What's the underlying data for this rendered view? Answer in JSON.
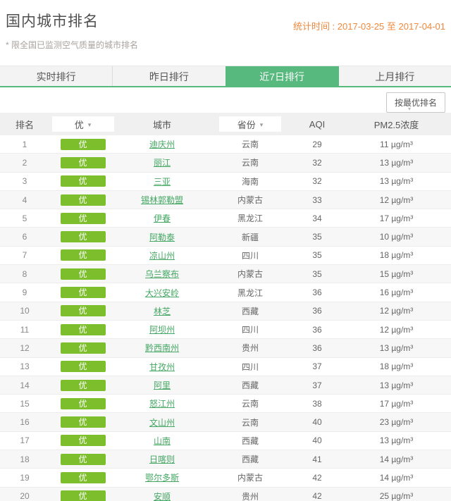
{
  "page": {
    "title": "国内城市排名",
    "subtitle": "* 限全国已监测空气质量的城市排名",
    "stat_time": "统计时间 : 2017-03-25 至 2017-04-01"
  },
  "colors": {
    "accent_green": "#57b97e",
    "badge_green": "#7dbe2d",
    "link_green": "#44a763",
    "stat_orange": "#f0883e",
    "header_bg": "#f0f0f0",
    "tab_bg": "#f3f3f3"
  },
  "icons": {
    "caret_down": "▾"
  },
  "tabs": [
    {
      "label": "实时排行",
      "active": false
    },
    {
      "label": "昨日排行",
      "active": false
    },
    {
      "label": "近7日排行",
      "active": true
    },
    {
      "label": "上月排行",
      "active": false
    }
  ],
  "toolbar": {
    "sort_button_label": "按最优排名"
  },
  "table": {
    "headers": {
      "rank": "排名",
      "level_filter": "优",
      "city": "城市",
      "province_filter": "省份",
      "aqi": "AQI",
      "pm25": "PM2.5浓度"
    },
    "rows": [
      {
        "rank": "1",
        "level": "优",
        "city": "迪庆州",
        "province": "云南",
        "aqi": "29",
        "pm25": "11 µg/m³"
      },
      {
        "rank": "2",
        "level": "优",
        "city": "丽江",
        "province": "云南",
        "aqi": "32",
        "pm25": "13 µg/m³"
      },
      {
        "rank": "3",
        "level": "优",
        "city": "三亚",
        "province": "海南",
        "aqi": "32",
        "pm25": "13 µg/m³"
      },
      {
        "rank": "4",
        "level": "优",
        "city": "锡林郭勒盟",
        "province": "内蒙古",
        "aqi": "33",
        "pm25": "12 µg/m³"
      },
      {
        "rank": "5",
        "level": "优",
        "city": "伊春",
        "province": "黑龙江",
        "aqi": "34",
        "pm25": "17 µg/m³"
      },
      {
        "rank": "6",
        "level": "优",
        "city": "阿勒泰",
        "province": "新疆",
        "aqi": "35",
        "pm25": "10 µg/m³"
      },
      {
        "rank": "7",
        "level": "优",
        "city": "凉山州",
        "province": "四川",
        "aqi": "35",
        "pm25": "18 µg/m³"
      },
      {
        "rank": "8",
        "level": "优",
        "city": "乌兰察布",
        "province": "内蒙古",
        "aqi": "35",
        "pm25": "15 µg/m³"
      },
      {
        "rank": "9",
        "level": "优",
        "city": "大兴安岭",
        "province": "黑龙江",
        "aqi": "36",
        "pm25": "16 µg/m³"
      },
      {
        "rank": "10",
        "level": "优",
        "city": "林芝",
        "province": "西藏",
        "aqi": "36",
        "pm25": "12 µg/m³"
      },
      {
        "rank": "11",
        "level": "优",
        "city": "阿坝州",
        "province": "四川",
        "aqi": "36",
        "pm25": "12 µg/m³"
      },
      {
        "rank": "12",
        "level": "优",
        "city": "黔西南州",
        "province": "贵州",
        "aqi": "36",
        "pm25": "13 µg/m³"
      },
      {
        "rank": "13",
        "level": "优",
        "city": "甘孜州",
        "province": "四川",
        "aqi": "37",
        "pm25": "18 µg/m³"
      },
      {
        "rank": "14",
        "level": "优",
        "city": "阿里",
        "province": "西藏",
        "aqi": "37",
        "pm25": "13 µg/m³"
      },
      {
        "rank": "15",
        "level": "优",
        "city": "怒江州",
        "province": "云南",
        "aqi": "38",
        "pm25": "17 µg/m³"
      },
      {
        "rank": "16",
        "level": "优",
        "city": "文山州",
        "province": "云南",
        "aqi": "40",
        "pm25": "23 µg/m³"
      },
      {
        "rank": "17",
        "level": "优",
        "city": "山南",
        "province": "西藏",
        "aqi": "40",
        "pm25": "13 µg/m³"
      },
      {
        "rank": "18",
        "level": "优",
        "city": "日喀则",
        "province": "西藏",
        "aqi": "41",
        "pm25": "14 µg/m³"
      },
      {
        "rank": "19",
        "level": "优",
        "city": "鄂尔多斯",
        "province": "内蒙古",
        "aqi": "42",
        "pm25": "14 µg/m³"
      },
      {
        "rank": "20",
        "level": "优",
        "city": "安顺",
        "province": "贵州",
        "aqi": "42",
        "pm25": "25 µg/m³"
      }
    ]
  }
}
